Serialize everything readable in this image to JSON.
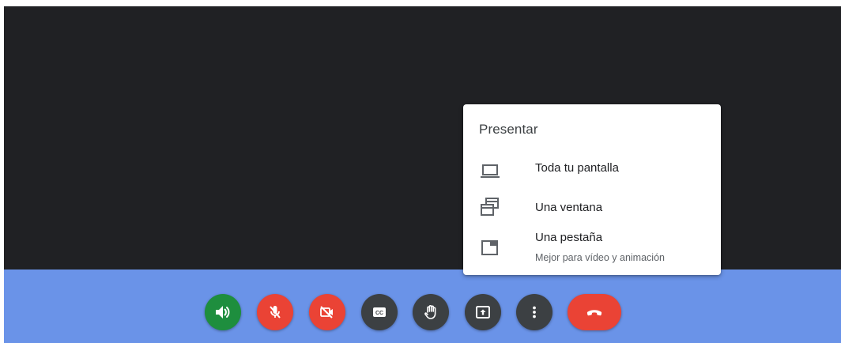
{
  "present_menu": {
    "title": "Presentar",
    "items": [
      {
        "label": "Toda tu pantalla",
        "icon": "laptop-icon"
      },
      {
        "label": "Una ventana",
        "icon": "window-icon"
      },
      {
        "label": "Una pestaña",
        "sublabel": "Mejor para vídeo y animación",
        "icon": "tab-icon"
      }
    ]
  },
  "controls": [
    {
      "name": "speaker-button",
      "icon": "volume-icon",
      "color": "#1e8e3e"
    },
    {
      "name": "microphone-off-button",
      "icon": "mic-off-icon",
      "color": "#ea4335"
    },
    {
      "name": "camera-off-button",
      "icon": "videocam-off-icon",
      "color": "#ea4335"
    },
    {
      "name": "captions-button",
      "icon": "closed-captions-icon",
      "color": "#3c4043"
    },
    {
      "name": "raise-hand-button",
      "icon": "hand-icon",
      "color": "#3c4043"
    },
    {
      "name": "present-button",
      "icon": "present-to-all-icon",
      "color": "#3c4043"
    },
    {
      "name": "more-options-button",
      "icon": "more-vert-icon",
      "color": "#3c4043"
    },
    {
      "name": "leave-call-button",
      "icon": "call-end-icon",
      "color": "#ea4335"
    }
  ],
  "colors": {
    "stage": "#202124",
    "toolbar": "#6a93e8",
    "menu_bg": "#ffffff"
  }
}
